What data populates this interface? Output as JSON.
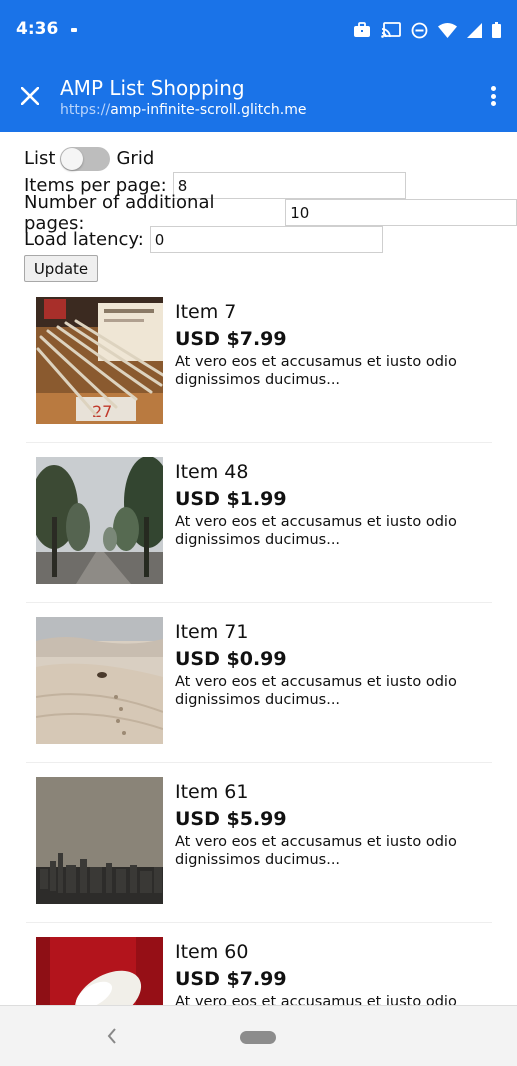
{
  "status_bar": {
    "time": "4:36",
    "icons": [
      "notification-dot-icon",
      "briefcase-icon",
      "cast-icon",
      "do-not-disturb-icon",
      "wifi-icon",
      "cell-signal-icon",
      "battery-icon"
    ]
  },
  "app_bar": {
    "title": "AMP List Shopping",
    "url_scheme": "https://",
    "url_host": "amp-infinite-scroll.glitch.me",
    "background": "#1a73e8"
  },
  "controls": {
    "list_label": "List",
    "grid_label": "Grid",
    "items_per_page_label": "Items per page:",
    "items_per_page_value": "8",
    "additional_pages_label": "Number of additional pages:",
    "additional_pages_value": "10",
    "latency_label": "Load latency:",
    "latency_value": "0",
    "update_label": "Update"
  },
  "products": [
    {
      "name": "Item 7",
      "price": "USD $7.99",
      "description": "At vero eos et accusamus et iusto odio dignissimos ducimus...",
      "image": "pencils-photo"
    },
    {
      "name": "Item 48",
      "price": "USD $1.99",
      "description": "At vero eos et accusamus et iusto odio dignissimos ducimus...",
      "image": "tree-road-photo"
    },
    {
      "name": "Item 71",
      "price": "USD $0.99",
      "description": "At vero eos et accusamus et iusto odio dignissimos ducimus...",
      "image": "desert-photo"
    },
    {
      "name": "Item 61",
      "price": "USD $5.99",
      "description": "At vero eos et accusamus et iusto odio dignissimos ducimus...",
      "image": "city-skyline-photo"
    },
    {
      "name": "Item 60",
      "price": "USD $7.99",
      "description": "At vero eos et accusamus et iusto odio dignissimos ducimus...",
      "image": "red-shoe-photo"
    }
  ]
}
